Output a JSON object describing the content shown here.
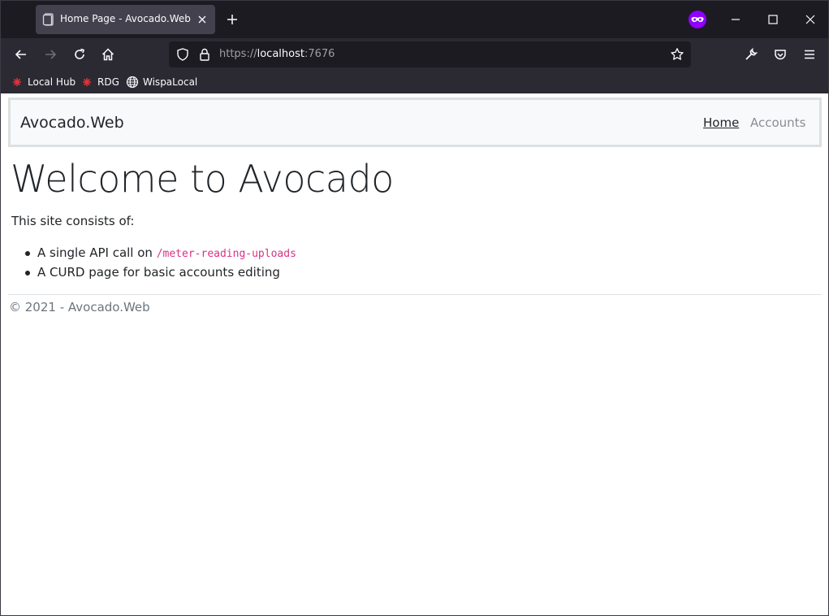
{
  "browser": {
    "tab": {
      "title": "Home Page - Avocado.Web"
    },
    "url": {
      "scheme": "https://",
      "host": "localhost",
      "port": ":7676"
    },
    "bookmarks": [
      {
        "label": "Local Hub",
        "icon": "red-star-icon"
      },
      {
        "label": "RDG",
        "icon": "red-star-icon"
      },
      {
        "label": "WispaLocal",
        "icon": "globe-icon"
      }
    ]
  },
  "site": {
    "brand": "Avocado.Web",
    "nav": [
      {
        "label": "Home",
        "active": true
      },
      {
        "label": "Accounts",
        "active": false
      }
    ],
    "heading": "Welcome to Avocado",
    "intro": "This site consists of:",
    "items": [
      {
        "text": "A single API call on ",
        "code": "/meter-reading-uploads"
      },
      {
        "text": "A CURD page for basic accounts editing"
      }
    ],
    "footer": "© 2021 - Avocado.Web"
  },
  "colors": {
    "tabstrip": "#1c1b22",
    "toolbar": "#2b2a33",
    "code": "#d63384",
    "private_accent": "#8f00ff"
  }
}
